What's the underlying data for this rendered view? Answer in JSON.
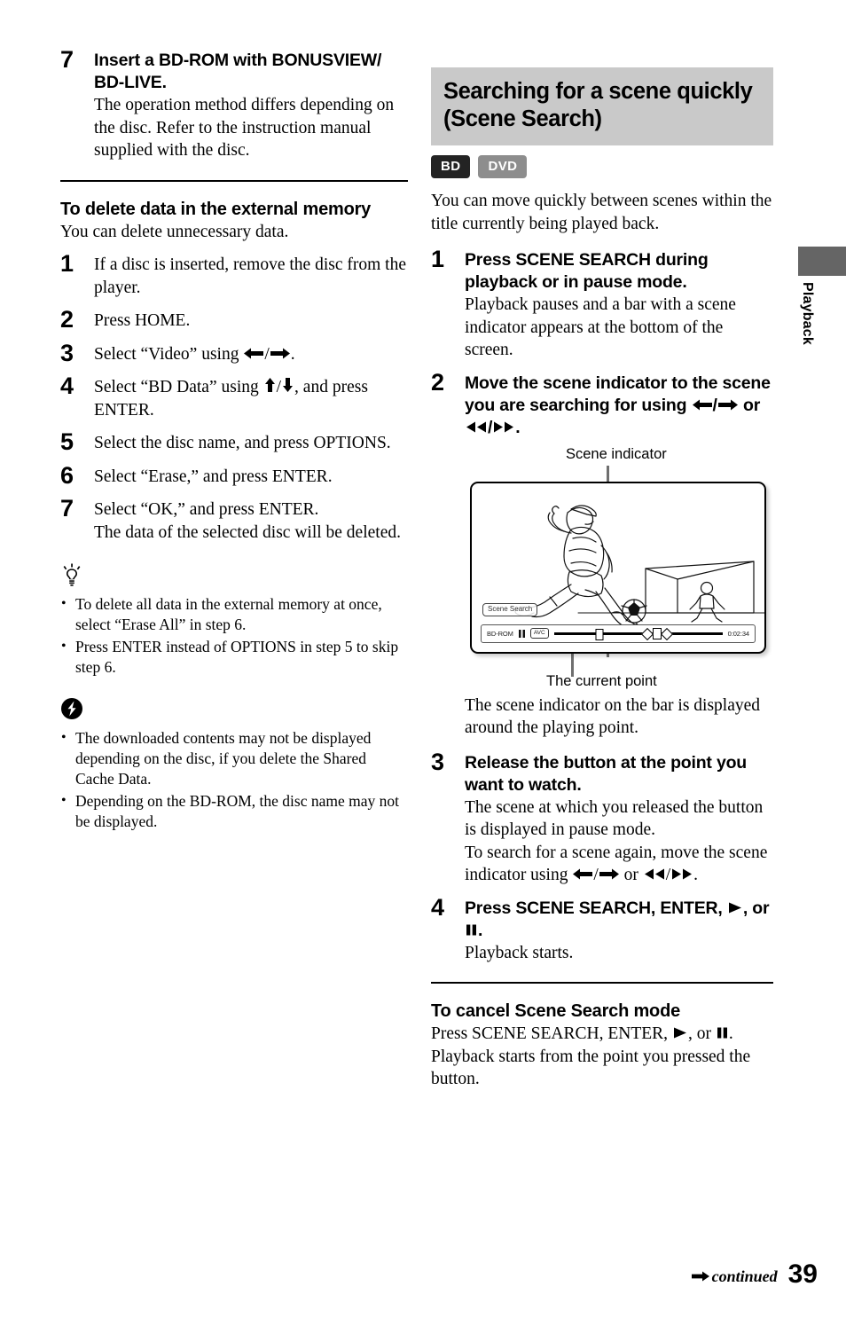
{
  "page": {
    "number": "39",
    "continued_label": "continued",
    "side_tab_label": "Playback"
  },
  "left_column": {
    "step7": {
      "number": "7",
      "title": "Insert a BD-ROM with BONUSVIEW/ BD-LIVE.",
      "desc": "The operation method differs depending on the disc. Refer to the instruction manual supplied with the disc."
    },
    "section": {
      "heading": "To delete data in the external memory",
      "intro": "You can delete unnecessary data.",
      "steps": [
        {
          "number": "1",
          "text": "If a disc is inserted, remove the disc from the player."
        },
        {
          "number": "2",
          "text": "Press HOME."
        },
        {
          "number": "3",
          "text_before": "Select “Video” using ",
          "arrows": "left-right",
          "text_after": "."
        },
        {
          "number": "4",
          "text_before": "Select “BD Data” using ",
          "arrows": "up-down",
          "text_after": ", and press ENTER."
        },
        {
          "number": "5",
          "text": "Select the disc name, and press OPTIONS."
        },
        {
          "number": "6",
          "text": "Select “Erase,” and press ENTER."
        },
        {
          "number": "7",
          "text": "Select “OK,” and press ENTER.",
          "extra": "The data of the selected disc will be deleted."
        }
      ]
    },
    "tip": {
      "icon": "lightbulb-icon",
      "bullets": [
        "To delete all data in the external memory at once, select “Erase All” in step 6.",
        "Press ENTER instead of OPTIONS in step 5 to skip step 6."
      ]
    },
    "note": {
      "icon": "caution-bolt-icon",
      "bullets": [
        "The downloaded contents may not be displayed depending on the disc, if you delete the Shared Cache Data.",
        "Depending on the BD-ROM, the disc name may not be displayed."
      ]
    }
  },
  "right_column": {
    "banner_title": "Searching for a scene quickly (Scene Search)",
    "badges": [
      {
        "label": "BD",
        "color": "#232323"
      },
      {
        "label": "DVD",
        "color": "#8d8d8d"
      }
    ],
    "intro": "You can move quickly between scenes within the title currently being played back.",
    "step1": {
      "number": "1",
      "title": "Press SCENE SEARCH during playback or in pause mode.",
      "desc": "Playback pauses and a bar with a scene indicator appears at the bottom of the screen."
    },
    "step2": {
      "number": "2",
      "title_before": "Move the scene indicator to the scene you are searching for using ",
      "title_mid": " or ",
      "title_after": ".",
      "arrows_1": "left-right",
      "arrows_2": "rewind-fastforward"
    },
    "figure": {
      "label_top": "Scene indicator",
      "label_bottom": "The current point",
      "osd": {
        "scene_search_chip": "Scene Search",
        "disc_type": "BD-ROM",
        "status_icon": "pause-icon",
        "codec": "AVC",
        "time": "0:02:34"
      }
    },
    "after_figure": "The scene indicator on the bar is displayed around the playing point.",
    "step3": {
      "number": "3",
      "title": "Release the button at the point you want to watch.",
      "desc_1": "The scene at which you released the button is displayed in pause mode.",
      "desc_2_before": "To search for a scene again, move the scene indicator using ",
      "desc_2_mid": " or ",
      "desc_2_after": "."
    },
    "step4": {
      "number": "4",
      "title_before": "Press SCENE SEARCH, ENTER, ",
      "title_mid": ", or ",
      "title_after": ".",
      "desc": "Playback starts."
    },
    "cancel": {
      "heading": "To cancel Scene Search mode",
      "text_before": "Press SCENE SEARCH, ENTER, ",
      "text_mid": ", or ",
      "text_after": ".",
      "text_rest": "Playback starts from the point you pressed the button."
    }
  }
}
